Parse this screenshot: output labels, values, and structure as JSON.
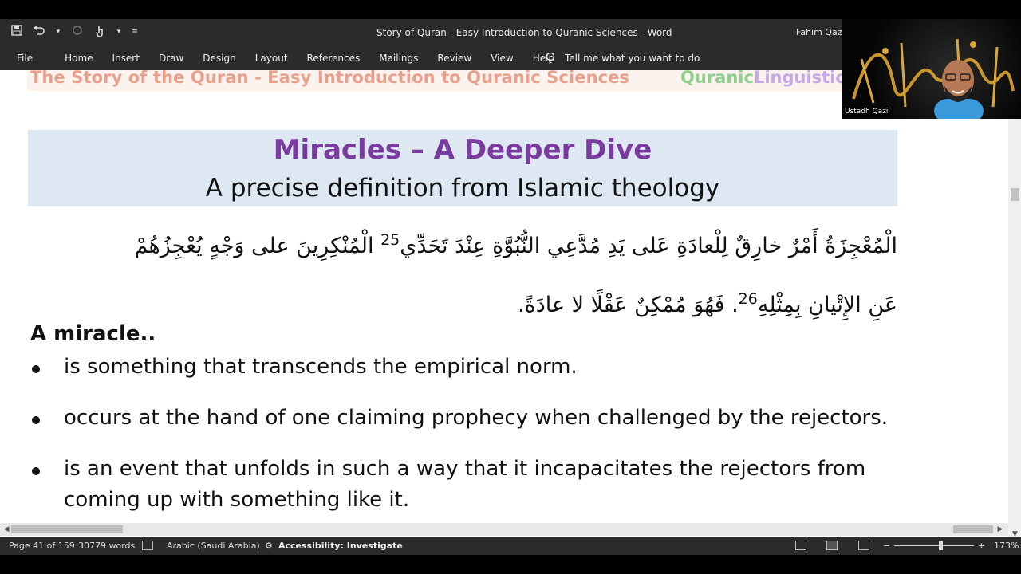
{
  "window": {
    "doc_title": "Story of Quran - Easy Introduction to Quranic Sciences  -  Word",
    "user": "Fahim Qazi"
  },
  "ribbon": {
    "tabs": [
      "File",
      "Home",
      "Insert",
      "Draw",
      "Design",
      "Layout",
      "References",
      "Mailings",
      "Review",
      "View",
      "Help"
    ],
    "tell_me": "Tell me what you want to do"
  },
  "document": {
    "header_title": "The Story of the Quran - Easy Introduction to Quranic Sciences",
    "header_brand_a": "Quranic",
    "header_brand_b": "Linguistics",
    "heading_title": "Miracles – A Deeper Dive",
    "heading_sub": "A precise definition from Islamic theology",
    "arabic_line1_a": "الْمُعْجِزَةُ أَمْرٌ خارِقٌ لِلْعادَةِ عَلى يَدِ مُدَّعِي النُّبُوَّةِ عِنْدَ تَحَدِّي",
    "arabic_sup1": "25",
    "arabic_line1_b": " الْمُنْكِرِينَ على وَجْهٍ يُعْجِزُهُمْ",
    "arabic_line2_a": "عَنِ الإِتْيانِ بِمِثْلِهِ",
    "arabic_sup2": "26",
    "arabic_line2_b": ". فَهُوَ مُمْكِنٌ عَقْلًا لا عادَةً.",
    "section_heading": "A miracle..",
    "bullets": [
      "is something that transcends the empirical norm.",
      "occurs at the hand of one claiming prophecy when challenged by the rejectors.",
      "is an event that unfolds in such a way that it incapacitates the rejectors from coming up with something like it."
    ]
  },
  "statusbar": {
    "page": "Page 41 of 159",
    "words": "30779 words",
    "language": "Arabic (Saudi Arabia)",
    "accessibility": "Accessibility: Investigate",
    "zoom": "173%"
  },
  "webcam": {
    "label": "Ustadh Qazi"
  },
  "colors": {
    "title_purple": "#7b3aa0",
    "header_salmon": "#e9a08d",
    "brand_green": "#8fd08f",
    "brand_purple": "#c4a8e8",
    "heading_bg": "#dde8f3"
  }
}
